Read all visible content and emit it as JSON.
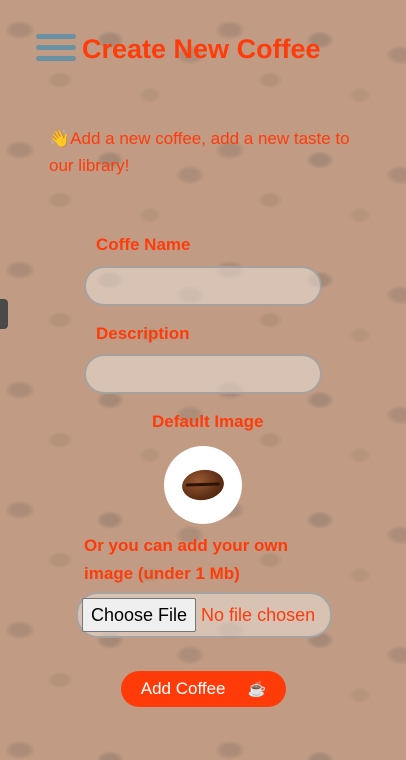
{
  "header": {
    "title": "Create New Coffee"
  },
  "intro": {
    "emoji": "👋",
    "text": "Add a new coffee, add a new taste to our library!"
  },
  "form": {
    "name_label": "Coffe Name",
    "name_value": "",
    "description_label": "Description",
    "description_value": "",
    "default_image_label": "Default Image",
    "own_image_label": "Or you can add your own image (under 1 Mb)",
    "choose_file_label": "Choose File",
    "no_file_text": "No file chosen",
    "submit_label": "Add Coffee",
    "submit_icon": "☕"
  },
  "icons": {
    "menu": "hamburger-menu-icon",
    "default_image": "coffee-bean-icon",
    "submit": "coffee-cup-icon"
  },
  "colors": {
    "accent": "#ff3b0a",
    "menu_icon": "#5a8fa8",
    "button_text": "#ffffff"
  }
}
